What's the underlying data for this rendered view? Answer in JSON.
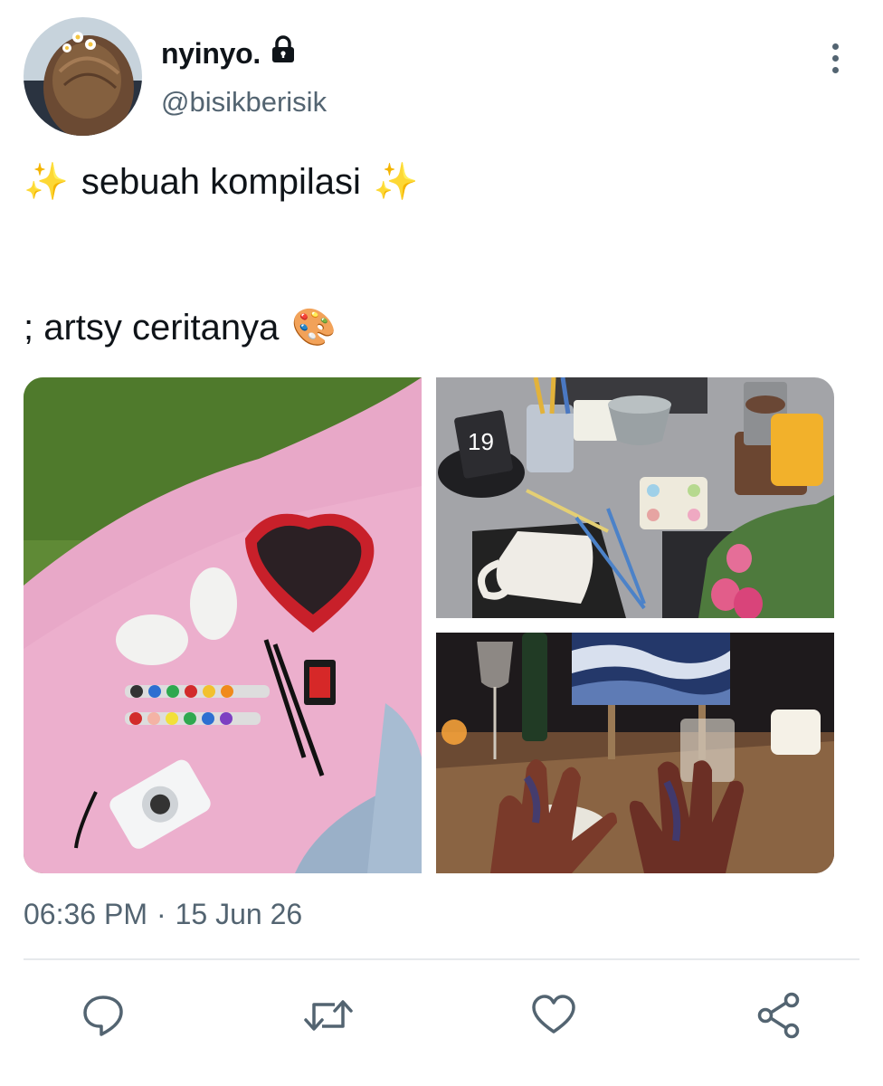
{
  "author": {
    "display_name": "nyinyo.",
    "handle": "@bisikberisik",
    "locked_icon": "lock-icon"
  },
  "tweet": {
    "line1_prefix": "✨",
    "line1_text": "sebuah kompilasi",
    "line1_suffix": "✨",
    "line2_text": "; artsy ceritanya",
    "line2_emoji": "🎨"
  },
  "media": [
    {
      "name": "picnic-blanket-photo"
    },
    {
      "name": "ceramic-cafe-table-photo"
    },
    {
      "name": "painting-hands-photo"
    }
  ],
  "meta": {
    "time": "06:36 PM",
    "separator": "·",
    "date": "15 Jun 26"
  },
  "actions": [
    "reply-icon",
    "retweet-icon",
    "like-icon",
    "share-icon"
  ],
  "colors": {
    "text": "#0f1419",
    "secondary": "#536471",
    "divider": "#e6e9ec"
  }
}
